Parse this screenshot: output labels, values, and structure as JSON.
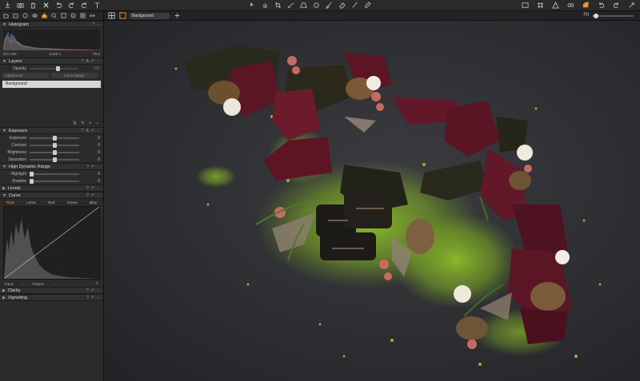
{
  "toolbar": {
    "left_icons": [
      "import-icon",
      "camera-icon",
      "trash-icon",
      "delete-icon",
      "undo-icon",
      "redo-icon",
      "redo2-icon",
      "text-icon"
    ],
    "center_icons": [
      "select-cursor-icon",
      "pan-hand-icon",
      "crop-icon",
      "straighten-icon",
      "keystone-icon",
      "spot-icon",
      "brush-icon",
      "eraser-icon",
      "gradient-icon",
      "picker-icon"
    ],
    "right_icons": [
      "display-icon",
      "grid-icon",
      "warning-icon",
      "glasses-icon",
      "layers-stack-icon",
      "rotate-left-icon",
      "rotate-right-icon",
      "reset-icon"
    ]
  },
  "viewer_bar": {
    "layer_select": "Background",
    "zoom_label": "Fit"
  },
  "panel": {
    "tabs": [
      "folder-tab",
      "capture-tab",
      "lens-tab",
      "color-tab",
      "exposure-tab",
      "detail-tab",
      "local-tab",
      "metadata-tab",
      "output-tab",
      "batch-tab"
    ],
    "histogram": {
      "title": "Histogram",
      "iso": "ISO 100",
      "shutter": "1/125 s",
      "aperture": "f/5.6"
    },
    "layers": {
      "title": "Layers",
      "opacity_label": "Opacity",
      "opacity_value": "100",
      "adjustment_pill": "Adjustment",
      "luma_pill": "Luma Range",
      "layer_name": "Background"
    },
    "exposure": {
      "title": "Exposure",
      "rows": [
        {
          "label": "Exposure",
          "value": "0"
        },
        {
          "label": "Contrast",
          "value": "0"
        },
        {
          "label": "Brightness",
          "value": "0"
        },
        {
          "label": "Saturation",
          "value": "0"
        }
      ]
    },
    "hdr": {
      "title": "High Dynamic Range",
      "rows": [
        {
          "label": "Highlight",
          "value": "0"
        },
        {
          "label": "Shadow",
          "value": "0"
        }
      ]
    },
    "levels": {
      "title": "Levels"
    },
    "curve": {
      "title": "Curve",
      "tabs": [
        "RGB",
        "Luma",
        "Red",
        "Green",
        "Blue"
      ],
      "input_label": "Input:",
      "input_value": "--",
      "output_label": "Output:",
      "output_value": "--"
    },
    "clarity": {
      "title": "Clarity"
    },
    "vignetting": {
      "title": "Vignetting"
    }
  },
  "colors": {
    "accent": "#f39a2b",
    "panel_bg": "#2b2b2b",
    "viewer_bg": "#2d2e31",
    "matcha": "#8bb82a"
  }
}
